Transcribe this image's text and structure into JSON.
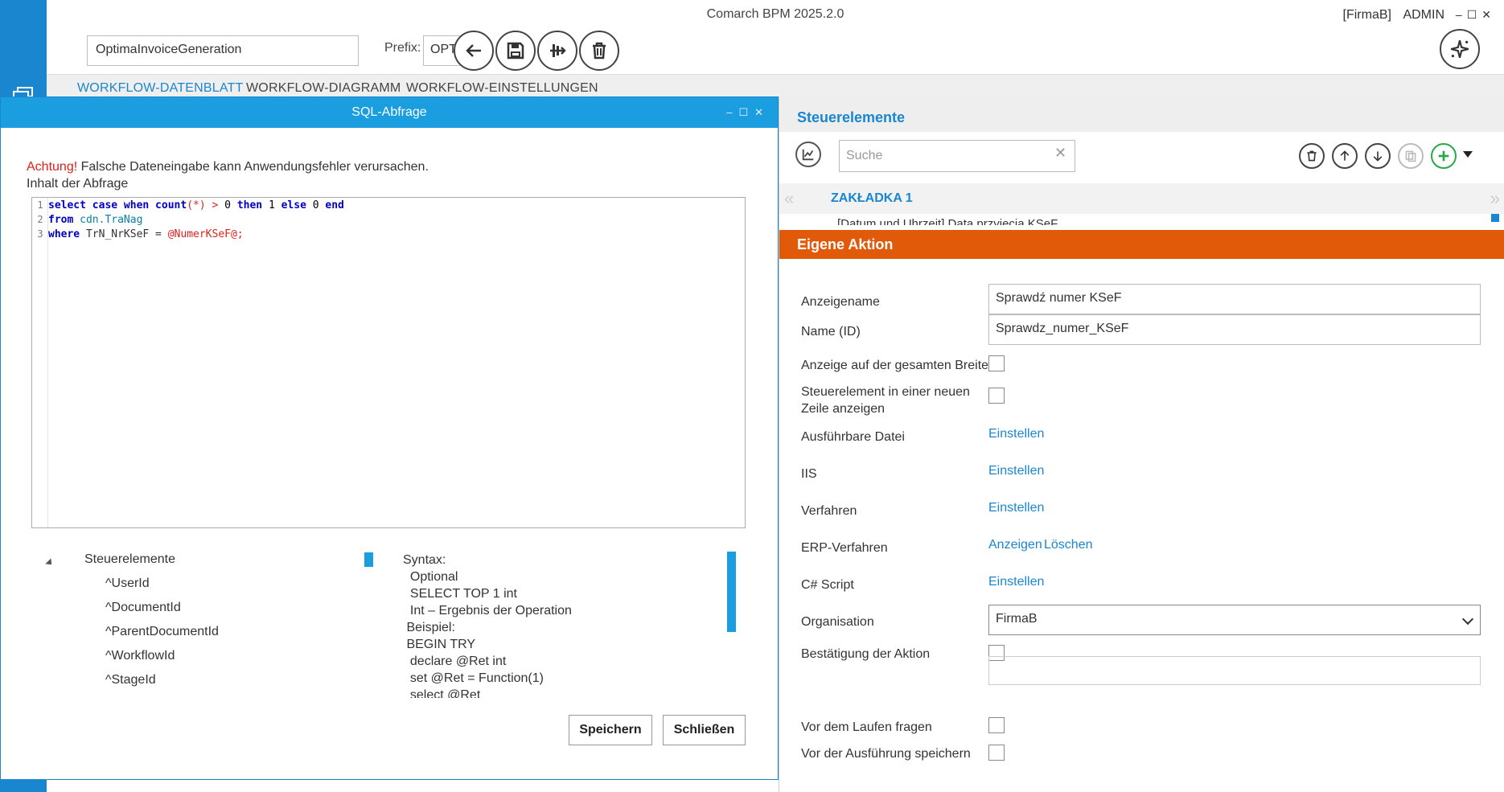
{
  "app": {
    "title": "Comarch BPM 2025.2.0",
    "company": "[FirmaB]",
    "user": "ADMIN",
    "window_controls": "–☐✕"
  },
  "header": {
    "workflow_name": "OptimaInvoiceGeneration",
    "prefix_label": "Prefix:",
    "prefix_value": "OPTI"
  },
  "tabs": [
    {
      "label": "WORKFLOW-DATENBLATT",
      "active": true
    },
    {
      "label": "WORKFLOW-DIAGRAMM",
      "active": false
    },
    {
      "label": "WORKFLOW-EINSTELLUNGEN",
      "active": false
    }
  ],
  "sql_dialog": {
    "title": "SQL-Abfrage",
    "window_controls": "–☐✕",
    "warning_prefix": "Achtung!",
    "warning_text": " Falsche Dateneingabe kann Anwendungsfehler verursachen.",
    "query_label": "Inhalt der Abfrage",
    "code_lines": [
      "select case when count(*) > 0 then 1 else 0 end",
      "from cdn.TraNag",
      "where TrN_NrKSeF = @NumerKSeF@;"
    ],
    "tree": {
      "root": "Steuerelemente",
      "children": [
        "^UserId",
        "^DocumentId",
        "^ParentDocumentId",
        "^WorkflowId",
        "^StageId"
      ]
    },
    "syntax_lines": [
      "Syntax:",
      "  Optional",
      "  SELECT TOP 1 int",
      "  Int – Ergebnis der Operation",
      " Beispiel:",
      " BEGIN TRY",
      "  declare @Ret int",
      "  set @Ret = Function(1)",
      "  select @Ret"
    ],
    "save_label": "Speichern",
    "close_label": "Schließen"
  },
  "right_panel": {
    "title": "Steuerelemente",
    "search_placeholder": "Suche",
    "tab_label": "ZAKŁADKA 1",
    "preview_field": "[Datum und Uhrzeit] Data przyjęcia KSeF",
    "action_header": "Eigene Aktion",
    "labels": {
      "display_name": "Anzeigename",
      "name_id": "Name (ID)",
      "full_width": "Anzeige auf der gesamten Breite",
      "new_line": "Steuerelement in einer neuen Zeile anzeigen",
      "executable": "Ausführbare Datei",
      "iis": "IIS",
      "procedure": "Verfahren",
      "erp_procedure": "ERP-Verfahren",
      "csharp": "C# Script",
      "organisation": "Organisation",
      "confirm": "Bestätigung der Aktion",
      "ask_before": "Vor dem Laufen fragen",
      "save_before": "Vor der Ausführung speichern"
    },
    "values": {
      "display_name": "Sprawdź numer KSeF",
      "name_id": "Sprawdz_numer_KSeF",
      "organisation": "FirmaB"
    },
    "links": {
      "set": "Einstellen",
      "show": "Anzeigen",
      "delete": "Löschen"
    }
  },
  "colors": {
    "accent": "#1a86d0",
    "action_header": "#e05a0a",
    "warning": "#e0201b"
  }
}
